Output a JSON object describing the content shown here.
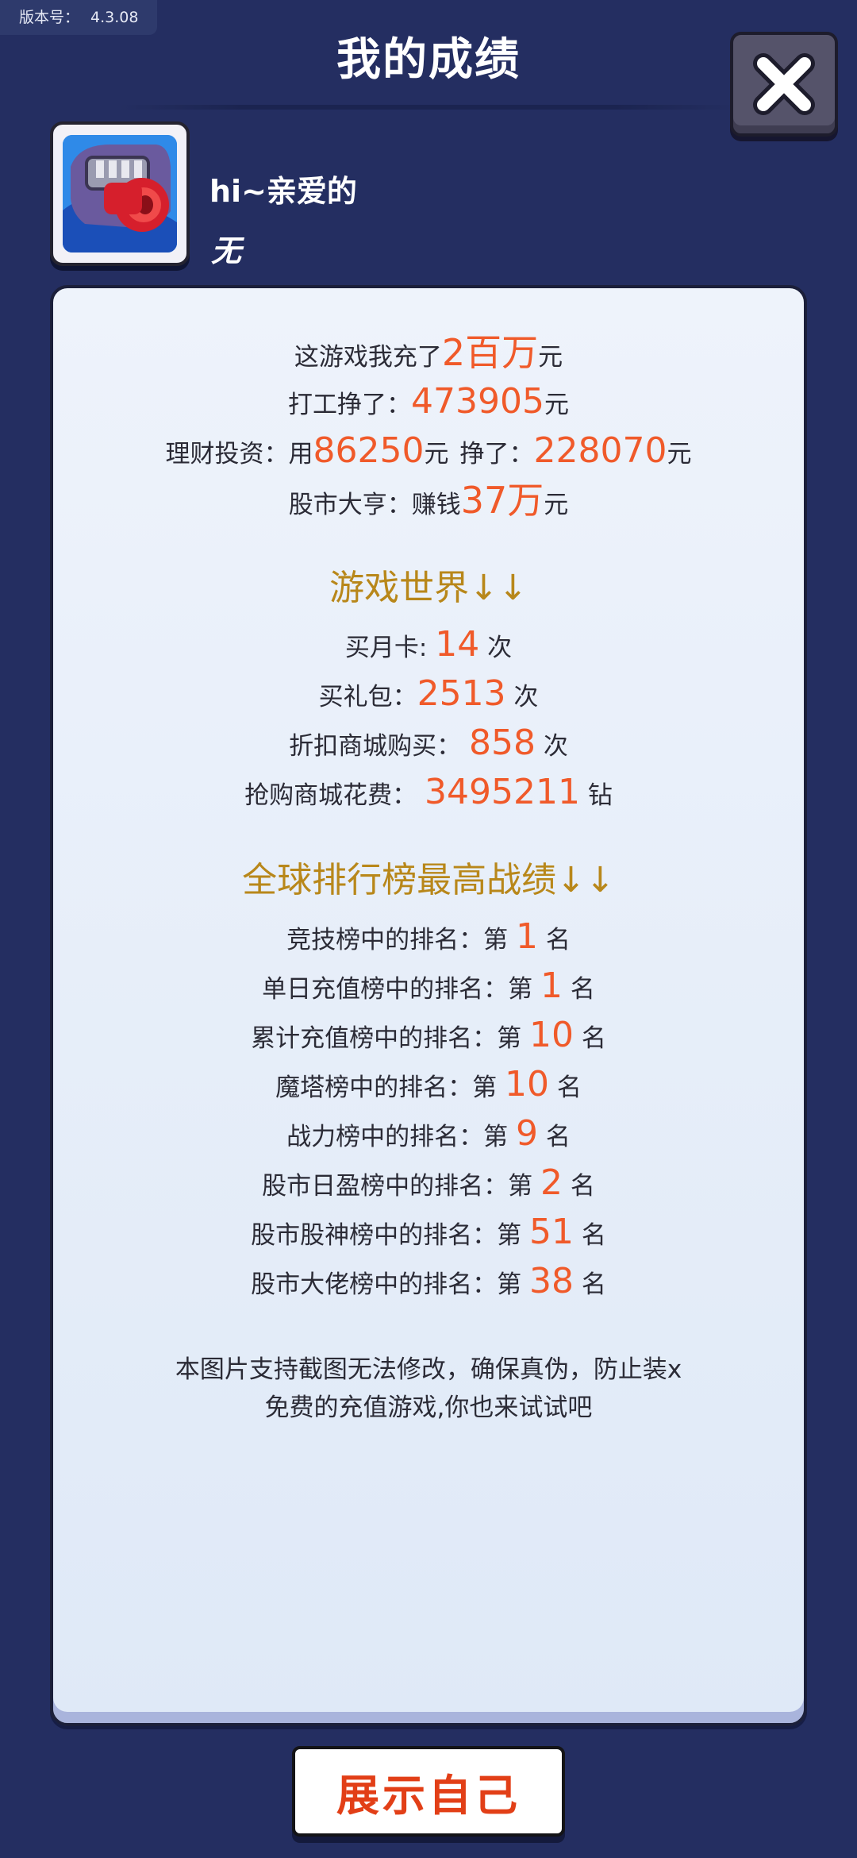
{
  "version": {
    "label": "版本号：",
    "value": "4.3.08"
  },
  "title": "我的成绩",
  "profile": {
    "greeting": "hi~亲爱的",
    "subtitle": "无"
  },
  "stats": {
    "recharge": {
      "prefix": "这游戏我充了",
      "value": "2百万",
      "suffix": "元"
    },
    "work": {
      "prefix": "打工挣了：",
      "value": "473905",
      "suffix": "元"
    },
    "invest": {
      "prefix": "理财投资：用",
      "used": "86250",
      "mid1": "元",
      "mid2": "挣了：",
      "earned": "228070",
      "suffix": "元"
    },
    "stock": {
      "prefix": "股市大亨：赚钱",
      "value": "37万",
      "suffix": "元"
    }
  },
  "game_world": {
    "title": "游戏世界↓↓",
    "items": [
      {
        "label": "买月卡:",
        "value": "14",
        "unit": "次"
      },
      {
        "label": "买礼包：",
        "value": "2513",
        "unit": "次"
      },
      {
        "label": "折扣商城购买：",
        "value": "858",
        "unit": "次"
      },
      {
        "label": "抢购商城花费：",
        "value": "3495211",
        "unit": "钻"
      }
    ]
  },
  "ranking": {
    "title": "全球排行榜最高战绩↓↓",
    "items": [
      {
        "label": "竞技榜中的排名：第",
        "value": "1",
        "unit": "名"
      },
      {
        "label": "单日充值榜中的排名：第",
        "value": "1",
        "unit": "名"
      },
      {
        "label": "累计充值榜中的排名：第",
        "value": "10",
        "unit": "名"
      },
      {
        "label": "魔塔榜中的排名：第",
        "value": "10",
        "unit": "名"
      },
      {
        "label": "战力榜中的排名：第",
        "value": "9",
        "unit": "名"
      },
      {
        "label": "股市日盈榜中的排名：第",
        "value": "2",
        "unit": "名"
      },
      {
        "label": "股市股神榜中的排名：第",
        "value": "51",
        "unit": "名"
      },
      {
        "label": "股市大佬榜中的排名：第",
        "value": "38",
        "unit": "名"
      }
    ]
  },
  "note": {
    "line1": "本图片支持截图无法修改，确保真伪，防止装x",
    "line2": "免费的充值游戏,你也来试试吧"
  },
  "buttons": {
    "show": "展示自己",
    "close_icon": "close-x-icon"
  }
}
